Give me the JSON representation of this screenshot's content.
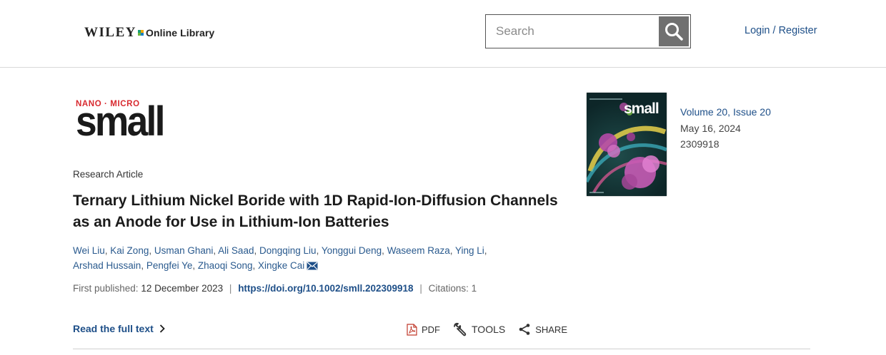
{
  "header": {
    "logo_brand": "WILEY",
    "logo_sub": "Online Library",
    "search_placeholder": "Search",
    "login_label": "Login / Register"
  },
  "journal": {
    "logo_top": "NANO · MICRO",
    "logo_main": "small",
    "cover_title": "small"
  },
  "article": {
    "type": "Research Article",
    "title": "Ternary Lithium Nickel Boride with 1D Rapid-Ion-Diffusion Channels as an Anode for Use in Lithium-Ion Batteries",
    "authors": [
      "Wei Liu",
      "Kai Zong",
      "Usman Ghani",
      "Ali Saad",
      "Dongqing Liu",
      "Yonggui Deng",
      "Waseem Raza",
      "Ying Li",
      "Arshad Hussain",
      "Pengfei Ye",
      "Zhaoqi Song",
      "Xingke Cai"
    ],
    "first_published_label": "First published:",
    "first_published_date": "12 December 2023",
    "doi": "https://doi.org/10.1002/smll.202309918",
    "citations": "Citations: 1"
  },
  "issue": {
    "volume": "Volume 20, Issue 20",
    "date": "May 16, 2024",
    "article_number": "2309918"
  },
  "actions": {
    "read_full": "Read the full text",
    "pdf": "PDF",
    "tools": "TOOLS",
    "share": "SHARE"
  },
  "colors": {
    "link": "#1e4f88",
    "brand_red": "#d8292f",
    "search_button": "#707070"
  }
}
